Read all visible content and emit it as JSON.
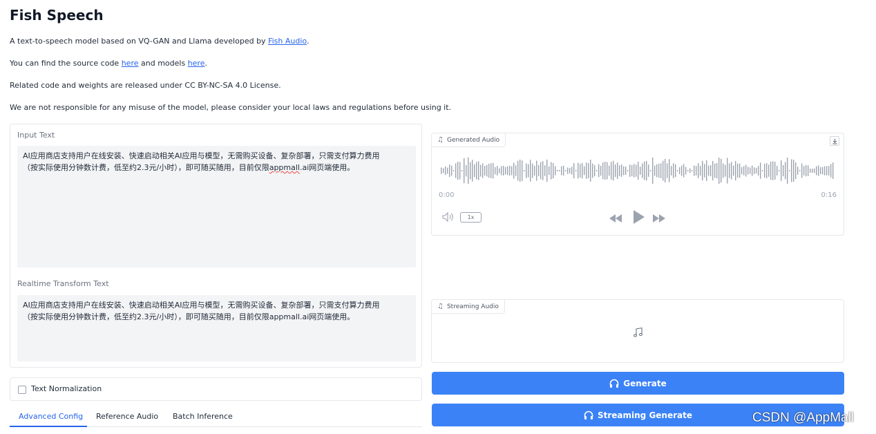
{
  "header": {
    "title": "Fish Speech",
    "intro_prefix": "A text-to-speech model based on VQ-GAN and Llama developed by ",
    "intro_link": "Fish Audio",
    "intro_suffix": ".",
    "source_prefix": "You can find the source code ",
    "source_link": "here",
    "source_middle": " and models ",
    "models_link": "here",
    "source_suffix": ".",
    "license_text": "Related code and weights are released under CC BY-NC-SA 4.0 License.",
    "disclaimer_text": "We are not responsible for any misuse of the model, please consider your local laws and regulations before using it."
  },
  "input_panel": {
    "input_label": "Input Text",
    "input_line1": "AI应用商店支持用户在线安装、快速启动相关AI应用与模型，无需购买设备、复杂部署，只需支付算力费用",
    "input_line2_a": "（按实际使用分钟数计费，低至约2.3元/小时），即可随买随用，目前仅限",
    "input_line2_b": "appmall",
    "input_line2_c": ".ai网页端使用。",
    "realtime_label": "Realtime Transform Text",
    "realtime_line1": "AI应用商店支持用户在线安装、快速启动相关AI应用与模型，无需购买设备、复杂部署，只需支付算力费用",
    "realtime_line2": "（按实际使用分钟数计费，低至约2.3元/小时），即可随买随用，目前仅限appmall.ai网页端使用。"
  },
  "normalization": {
    "label": "Text Normalization",
    "checked": false
  },
  "tabs": [
    {
      "label": "Advanced Config",
      "active": true
    },
    {
      "label": "Reference Audio",
      "active": false
    },
    {
      "label": "Batch Inference",
      "active": false
    }
  ],
  "generated_audio": {
    "label": "Generated Audio",
    "time_start": "0:00",
    "time_end": "0:16",
    "speed": "1x"
  },
  "streaming_audio": {
    "label": "Streaming Audio"
  },
  "buttons": {
    "generate": "Generate",
    "streaming_generate": "Streaming Generate"
  },
  "watermark": "CSDN @AppMall",
  "colors": {
    "accent": "#3b82f6",
    "link": "#2563eb",
    "panel_border": "#e5e7eb",
    "textarea_bg": "#f3f4f6"
  },
  "icons": {
    "music_note": "music-note-icon",
    "download": "download-icon",
    "volume": "volume-icon",
    "rewind": "rewind-icon",
    "play": "play-icon",
    "fast_forward": "fast-forward-icon",
    "headphones": "headphones-icon"
  }
}
